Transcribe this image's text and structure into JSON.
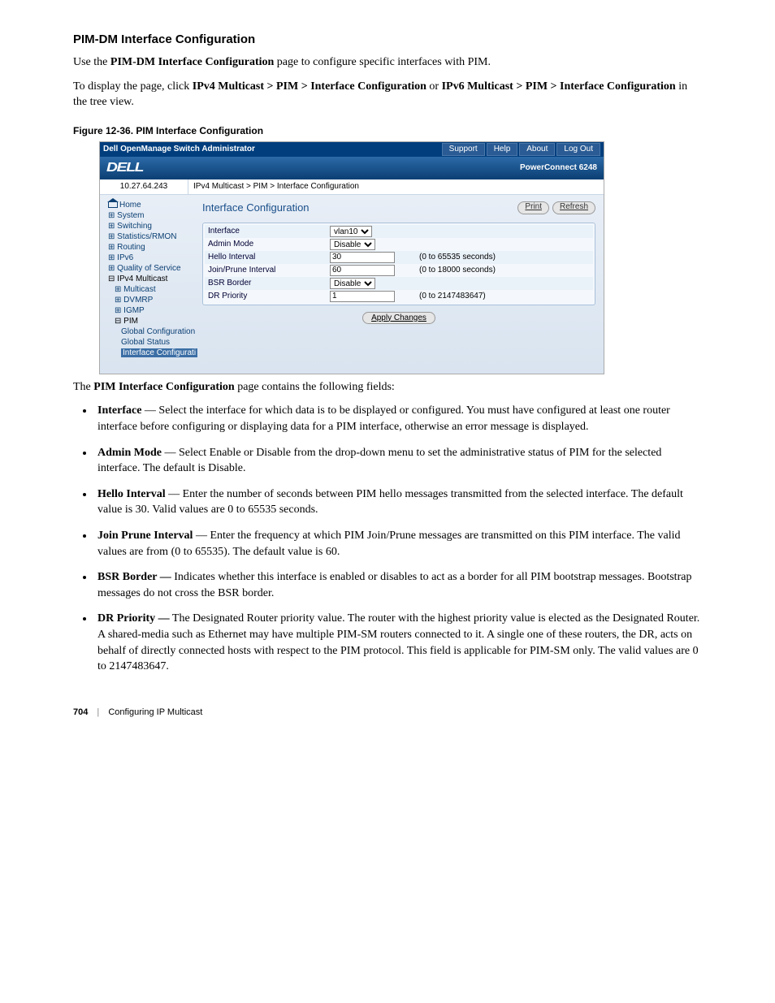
{
  "heading": "PIM-DM Interface Configuration",
  "intro_pre": "Use the ",
  "intro_bold": "PIM-DM Interface Configuration",
  "intro_post": " page to configure specific interfaces with PIM.",
  "nav_sentence": {
    "pre": "To display the page, click ",
    "path1": "IPv4 Multicast > PIM > Interface Configuration",
    "mid": " or ",
    "path2": "IPv6 Multicast > PIM > Interface Configuration",
    "post": " in the tree view."
  },
  "figure_caption": "Figure 12-36.    PIM Interface Configuration",
  "screenshot": {
    "top_title": "Dell OpenManage Switch Administrator",
    "top_links": [
      "Support",
      "Help",
      "About",
      "Log Out"
    ],
    "logo": "DELL",
    "model": "PowerConnect 6248",
    "ip": "10.27.64.243",
    "breadcrumb": "IPv4 Multicast > PIM > Interface Configuration",
    "nav": {
      "home": "Home",
      "items": [
        "System",
        "Switching",
        "Statistics/RMON",
        "Routing",
        "IPv6",
        "Quality of Service"
      ],
      "open_root": "IPv4 Multicast",
      "open_children": [
        "Multicast",
        "DVMRP",
        "IGMP"
      ],
      "pim": "PIM",
      "pim_children": [
        "Global Configuration",
        "Global Status"
      ],
      "pim_selected": "Interface Configurati"
    },
    "page_title": "Interface Configuration",
    "buttons": {
      "print": "Print",
      "refresh": "Refresh",
      "apply": "Apply Changes"
    },
    "form": {
      "rows": [
        {
          "label": "Interface",
          "type": "select",
          "value": "vlan10",
          "hint": ""
        },
        {
          "label": "Admin Mode",
          "type": "select",
          "value": "Disable",
          "hint": ""
        },
        {
          "label": "Hello Interval",
          "type": "input",
          "value": "30",
          "hint": "(0 to 65535 seconds)"
        },
        {
          "label": "Join/Prune Interval",
          "type": "input",
          "value": "60",
          "hint": "(0 to 18000 seconds)"
        },
        {
          "label": "BSR Border",
          "type": "select",
          "value": "Disable",
          "hint": ""
        },
        {
          "label": "DR Priority",
          "type": "input",
          "value": "1",
          "hint": "(0 to 2147483647)"
        }
      ]
    }
  },
  "after_fig_pre": "The ",
  "after_fig_bold": "PIM Interface Configuration",
  "after_fig_post": " page contains the following fields:",
  "fields": [
    {
      "name": "Interface",
      "desc": " — Select the interface for which data is to be displayed or configured. You must have configured at least one router interface before configuring or displaying data for a PIM interface, otherwise an error message is displayed."
    },
    {
      "name": "Admin Mode",
      "desc": " — Select Enable or Disable from the drop-down menu to set the administrative status of PIM for the selected interface. The default is Disable."
    },
    {
      "name": "Hello Interval",
      "desc": " — Enter the number of seconds between PIM hello messages transmitted from the selected interface. The default value is 30. Valid values are 0 to 65535 seconds."
    },
    {
      "name": "Join Prune Interval",
      "desc": " — Enter the frequency at which PIM Join/Prune messages are transmitted on this PIM interface. The valid values are from (0 to 65535). The default value is 60."
    },
    {
      "name": "BSR Border —",
      "desc": " Indicates whether this interface is enabled or disables to act as a border for all PIM bootstrap messages. Bootstrap messages do not cross the BSR border."
    },
    {
      "name": "DR Priority —",
      "desc": " The Designated Router priority value. The router with the highest priority value is elected as the Designated Router. A shared-media such as Ethernet may have multiple PIM-SM routers connected to it. A single one of these routers, the DR, acts on behalf of directly connected hosts with respect to the PIM protocol. This field is applicable for PIM-SM only. The valid values are 0 to 2147483647."
    }
  ],
  "footer": {
    "page": "704",
    "section": "Configuring IP Multicast"
  }
}
